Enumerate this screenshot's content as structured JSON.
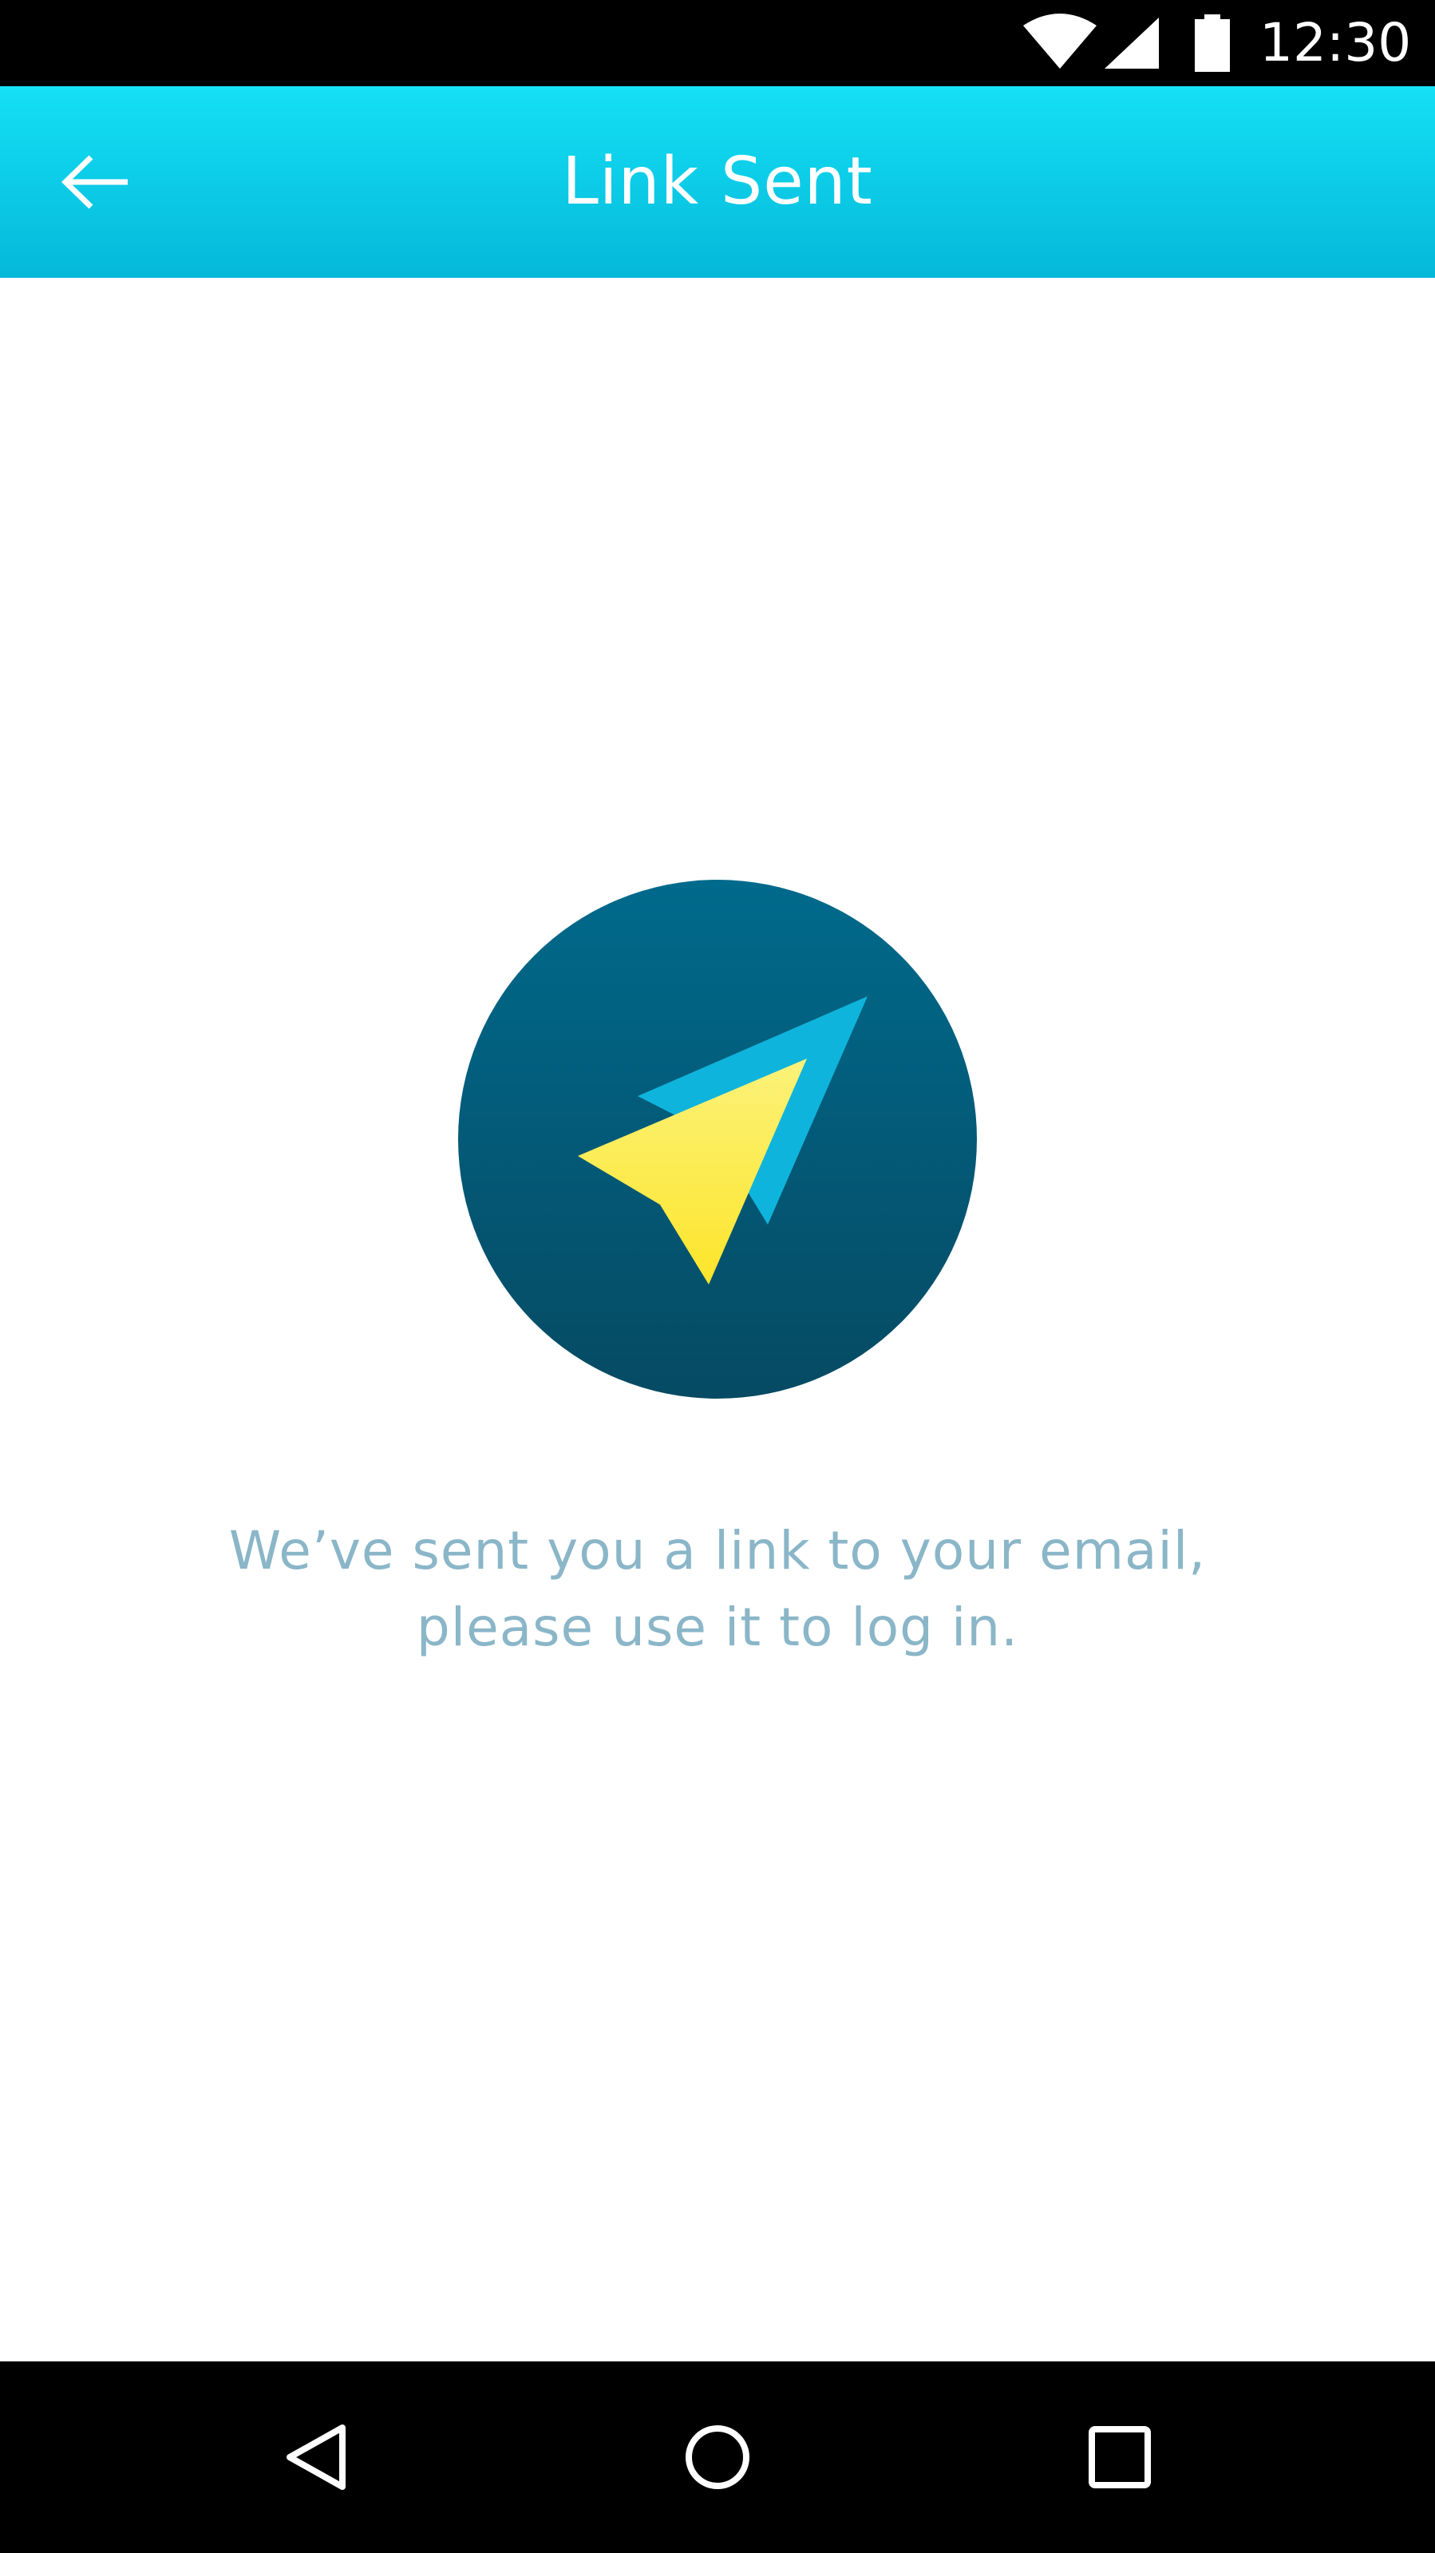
{
  "status_bar": {
    "time": "12:30",
    "icons": [
      "wifi-icon",
      "signal-icon",
      "battery-icon"
    ]
  },
  "app_bar": {
    "title": "Link Sent",
    "back_icon": "arrow-back-icon",
    "gradient": [
      "#14e0f4",
      "#05b8da"
    ]
  },
  "main": {
    "illustration": "paper-plane-icon",
    "message_line1": "We’ve sent you a link to your email,",
    "message_line2": "please use it to log in.",
    "colors": {
      "circle_top": "#006a8c",
      "circle_bottom": "#064a63",
      "plane_front": "#fde93a",
      "plane_back": "#0fb4dc",
      "message": "#8ab6c8"
    }
  },
  "nav_bar": {
    "icons": [
      "nav-back-icon",
      "nav-home-icon",
      "nav-recents-icon"
    ]
  }
}
